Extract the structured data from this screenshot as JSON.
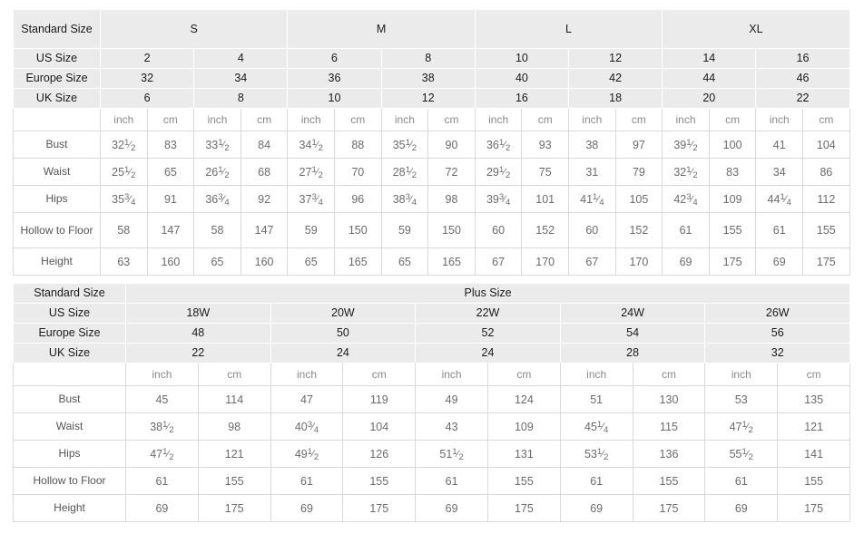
{
  "standard_table": {
    "corner_label": "Standard Size",
    "size_groups": [
      {
        "label": "S",
        "span": 4
      },
      {
        "label": "M",
        "span": 4
      },
      {
        "label": "L",
        "span": 4
      },
      {
        "label": "XL",
        "span": 4
      }
    ],
    "rows_header": [
      {
        "label": "US Size",
        "values": [
          "2",
          "4",
          "6",
          "8",
          "10",
          "12",
          "14",
          "16"
        ]
      },
      {
        "label": "Europe Size",
        "values": [
          "32",
          "34",
          "36",
          "38",
          "40",
          "42",
          "44",
          "46"
        ]
      },
      {
        "label": "UK Size",
        "values": [
          "6",
          "8",
          "10",
          "12",
          "16",
          "18",
          "20",
          "22"
        ]
      }
    ],
    "unit_row": {
      "label": "",
      "units": [
        "inch",
        "cm",
        "inch",
        "cm",
        "inch",
        "cm",
        "inch",
        "cm",
        "inch",
        "cm",
        "inch",
        "cm",
        "inch",
        "cm",
        "inch",
        "cm"
      ]
    },
    "measure_rows": [
      {
        "label": "Bust",
        "tall": false,
        "values": [
          "32 1/2",
          "83",
          "33 1/2",
          "84",
          "34 1/2",
          "88",
          "35 1/2",
          "90",
          "36 1/2",
          "93",
          "38",
          "97",
          "39 1/2",
          "100",
          "41",
          "104"
        ]
      },
      {
        "label": "Waist",
        "tall": false,
        "values": [
          "25 1/2",
          "65",
          "26 1/2",
          "68",
          "27 1/2",
          "70",
          "28 1/2",
          "72",
          "29 1/2",
          "75",
          "31",
          "79",
          "32 1/2",
          "83",
          "34",
          "86"
        ]
      },
      {
        "label": "Hips",
        "tall": false,
        "values": [
          "35 3/4",
          "91",
          "36 3/4",
          "92",
          "37 3/4",
          "96",
          "38 3/4",
          "98",
          "39 3/4",
          "101",
          "41 1/4",
          "105",
          "42 3/4",
          "109",
          "44 1/4",
          "112"
        ]
      },
      {
        "label": "Hollow to Floor",
        "tall": true,
        "values": [
          "58",
          "147",
          "58",
          "147",
          "59",
          "150",
          "59",
          "150",
          "60",
          "152",
          "60",
          "152",
          "61",
          "155",
          "61",
          "155"
        ]
      },
      {
        "label": "Height",
        "tall": false,
        "values": [
          "63",
          "160",
          "65",
          "160",
          "65",
          "165",
          "65",
          "165",
          "67",
          "170",
          "67",
          "170",
          "69",
          "175",
          "69",
          "175"
        ]
      }
    ]
  },
  "plus_table": {
    "corner_label": "Standard Size",
    "group_label": "Plus Size",
    "rows_header": [
      {
        "label": "US Size",
        "values": [
          "18W",
          "20W",
          "22W",
          "24W",
          "26W"
        ]
      },
      {
        "label": "Europe Size",
        "values": [
          "48",
          "50",
          "52",
          "54",
          "56"
        ]
      },
      {
        "label": "UK Size",
        "values": [
          "22",
          "24",
          "24",
          "28",
          "32"
        ]
      }
    ],
    "unit_row": {
      "label": "",
      "units": [
        "inch",
        "cm",
        "inch",
        "cm",
        "inch",
        "cm",
        "inch",
        "cm",
        "inch",
        "cm"
      ]
    },
    "measure_rows": [
      {
        "label": "Bust",
        "values": [
          "45",
          "114",
          "47",
          "119",
          "49",
          "124",
          "51",
          "130",
          "53",
          "135"
        ]
      },
      {
        "label": "Waist",
        "values": [
          "38 1/2",
          "98",
          "40 3/4",
          "104",
          "43",
          "109",
          "45 1/4",
          "115",
          "47 1/2",
          "121"
        ]
      },
      {
        "label": "Hips",
        "values": [
          "47 1/2",
          "121",
          "49 1/2",
          "126",
          "51 1/2",
          "131",
          "53 1/2",
          "136",
          "55 1/2",
          "141"
        ]
      },
      {
        "label": "Hollow to Floor",
        "values": [
          "61",
          "155",
          "61",
          "155",
          "61",
          "155",
          "61",
          "155",
          "61",
          "155"
        ]
      },
      {
        "label": "Height",
        "values": [
          "69",
          "175",
          "69",
          "175",
          "69",
          "175",
          "69",
          "175",
          "69",
          "175"
        ]
      }
    ]
  },
  "colors": {
    "header_bg": "#ebebeb",
    "cell_border": "#d9d9d9",
    "header_text": "#1a1a1a",
    "value_text": "#6b6b6b",
    "unit_text": "#8a8a8a",
    "page_bg": "#ffffff"
  }
}
